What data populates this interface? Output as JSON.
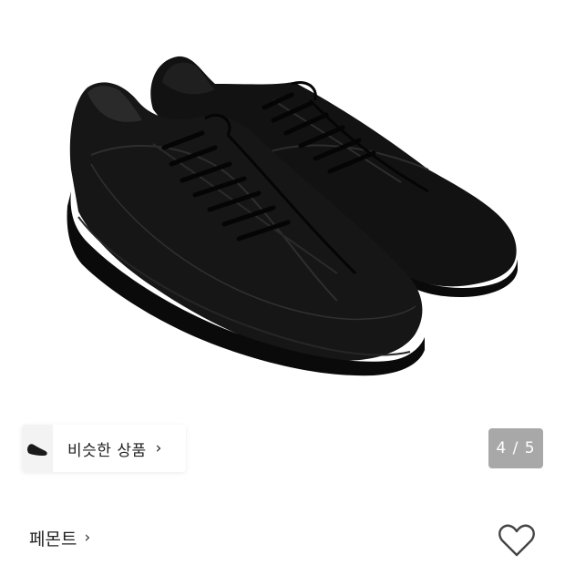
{
  "product": {
    "image_alt_icon": "black-leather-sneakers-image",
    "similar_label": "비슷한 상품",
    "similar_chevron": "›",
    "page_counter": "4 / 5",
    "brand_name": "페몬트",
    "brand_chevron": "›",
    "wishlist_icon": "heart-outline-icon"
  },
  "colors": {
    "counter_bg": "#a8a8a8",
    "shoe": "#141414"
  }
}
